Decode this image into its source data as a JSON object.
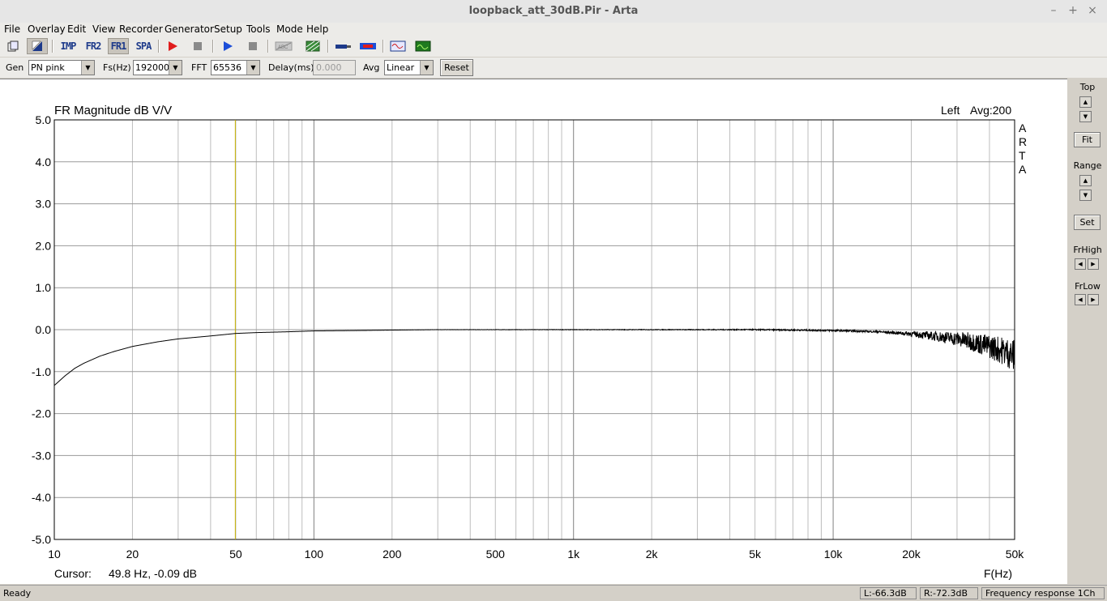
{
  "window": {
    "title": "loopback_att_30dB.Pir - Arta"
  },
  "menu": [
    "File",
    "Overlay",
    "Edit",
    "View",
    "Recorder",
    "Generator",
    "Setup",
    "Tools",
    "Mode",
    "Help"
  ],
  "toolbar": {
    "imp_label": "IMP",
    "fr2_label": "FR2",
    "fr1_label": "FR1",
    "spa_label": "SPA",
    "icons": [
      "file-icon",
      "overlay-icon",
      "record-icon",
      "stop-icon",
      "play-icon",
      "stop-icon",
      "abc-icon",
      "grid-icon",
      "probe-icon",
      "levels-icon",
      "generator-icon",
      "scope-icon"
    ]
  },
  "controls": {
    "gen_label": "Gen",
    "gen_value": "PN pink",
    "fs_label": "Fs(Hz)",
    "fs_value": "192000",
    "fft_label": "FFT",
    "fft_value": "65536",
    "delay_label": "Delay(ms)",
    "delay_value": "0.000",
    "avg_label": "Avg",
    "avg_value": "Linear",
    "reset_label": "Reset"
  },
  "side": {
    "top_label": "Top",
    "fit_label": "Fit",
    "range_label": "Range",
    "set_label": "Set",
    "frhigh_label": "FrHigh",
    "frlow_label": "FrLow"
  },
  "plot": {
    "title": "FR Magnitude dB V/V",
    "channel": "Left",
    "avg_text": "Avg:200",
    "brand_letters": [
      "A",
      "R",
      "T",
      "A"
    ],
    "cursor_label": "Cursor:",
    "cursor_value": "49.8 Hz, -0.09 dB",
    "x_unit": "F(Hz)"
  },
  "chart_data": {
    "type": "line",
    "x_scale": "log",
    "xlim": [
      10,
      50000
    ],
    "ylim": [
      -5,
      5
    ],
    "y_ticks": [
      -5,
      -4,
      -3,
      -2,
      -1,
      0,
      1,
      2,
      3,
      4,
      5
    ],
    "y_tick_labels": [
      "-5.0",
      "-4.0",
      "-3.0",
      "-2.0",
      "-1.0",
      "0.0",
      "1.0",
      "2.0",
      "3.0",
      "4.0",
      "5.0"
    ],
    "x_ticks": [
      10,
      20,
      50,
      100,
      200,
      500,
      1000,
      2000,
      5000,
      10000,
      20000,
      50000
    ],
    "x_tick_labels": [
      "10",
      "20",
      "50",
      "100",
      "200",
      "500",
      "1k",
      "2k",
      "5k",
      "10k",
      "20k",
      "50k"
    ],
    "grid": true,
    "cursor_x": 49.8,
    "cursor_color": "#c8b400",
    "line_color": "#000000",
    "series": [
      {
        "x": [
          10,
          11,
          12,
          13,
          15,
          17,
          20,
          25,
          30,
          40,
          50,
          60,
          80,
          100,
          150,
          200,
          300,
          500,
          1000,
          2000,
          5000,
          10000,
          15000,
          20000,
          25000,
          30000,
          35000,
          40000,
          45000,
          50000
        ],
        "values": [
          -1.33,
          -1.1,
          -0.92,
          -0.8,
          -0.63,
          -0.52,
          -0.4,
          -0.29,
          -0.22,
          -0.15,
          -0.09,
          -0.07,
          -0.05,
          -0.03,
          -0.02,
          -0.01,
          0.0,
          0.0,
          0.0,
          0.0,
          0.0,
          -0.02,
          -0.05,
          -0.1,
          -0.16,
          -0.22,
          -0.3,
          -0.4,
          -0.5,
          -0.62
        ]
      }
    ]
  },
  "status": {
    "left": "Ready",
    "level_l": "L:-66.3dB",
    "level_r": "R:-72.3dB",
    "mode": "Frequency response 1Ch"
  }
}
